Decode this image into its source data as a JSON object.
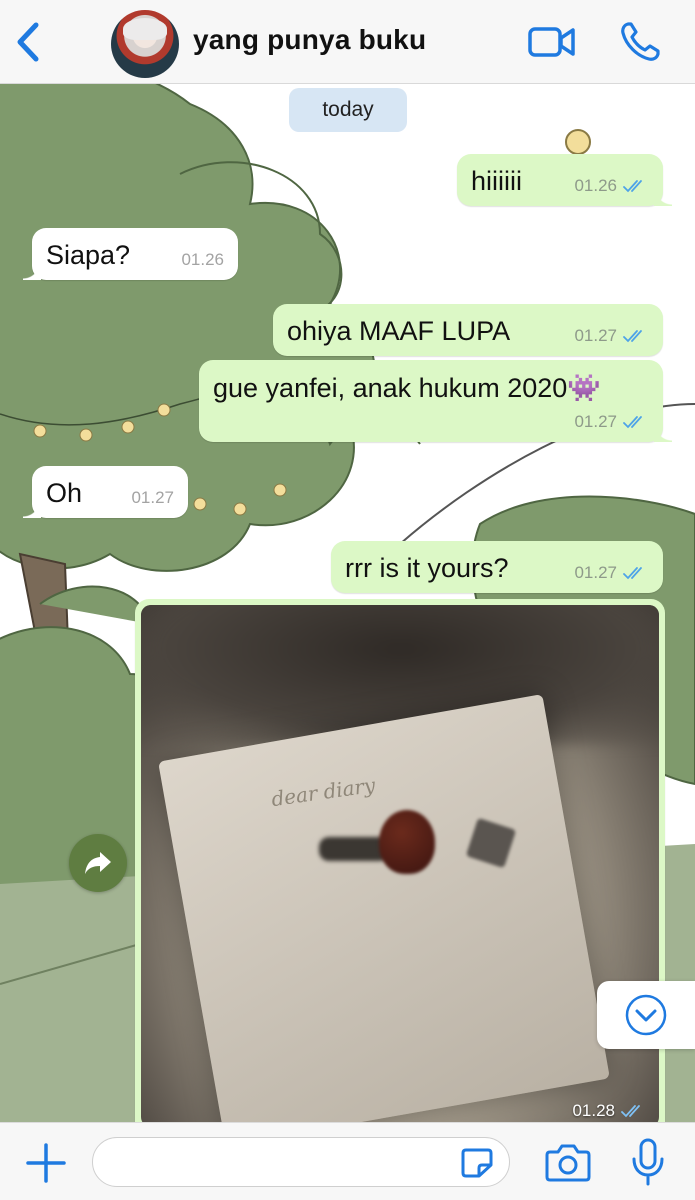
{
  "header": {
    "contact_name": "yang punya buku",
    "back_icon": "chevron-left-icon",
    "video_icon": "video-camera-icon",
    "call_icon": "phone-icon",
    "accent_color": "#1f7ae0"
  },
  "chat": {
    "date_chip": "today",
    "messages": [
      {
        "direction": "out",
        "text": "hiiiiii",
        "time": "01.26",
        "status": "read"
      },
      {
        "direction": "in",
        "text": "Siapa?",
        "time": "01.26"
      },
      {
        "direction": "out",
        "text": "ohiya MAAF LUPA",
        "time": "01.27",
        "status": "read"
      },
      {
        "direction": "out",
        "text": "gue yanfei, anak hukum 2020👾",
        "time": "01.27",
        "status": "read"
      },
      {
        "direction": "in",
        "text": "Oh",
        "time": "01.27"
      },
      {
        "direction": "out",
        "text": "rrr is it yours?",
        "time": "01.27",
        "status": "read"
      },
      {
        "direction": "out",
        "type": "image",
        "image_text": "dear diary",
        "time": "01.28",
        "status": "read"
      }
    ],
    "outgoing_bubble_color": "#dcf8c6",
    "incoming_bubble_color": "#ffffff",
    "forward_icon": "forward-arrow-icon",
    "scroll_down_icon": "chevron-down-circle-icon"
  },
  "input_bar": {
    "plus_icon": "plus-icon",
    "message_value": "",
    "sticker_icon": "sticker-icon",
    "camera_icon": "camera-icon",
    "mic_icon": "microphone-icon"
  }
}
